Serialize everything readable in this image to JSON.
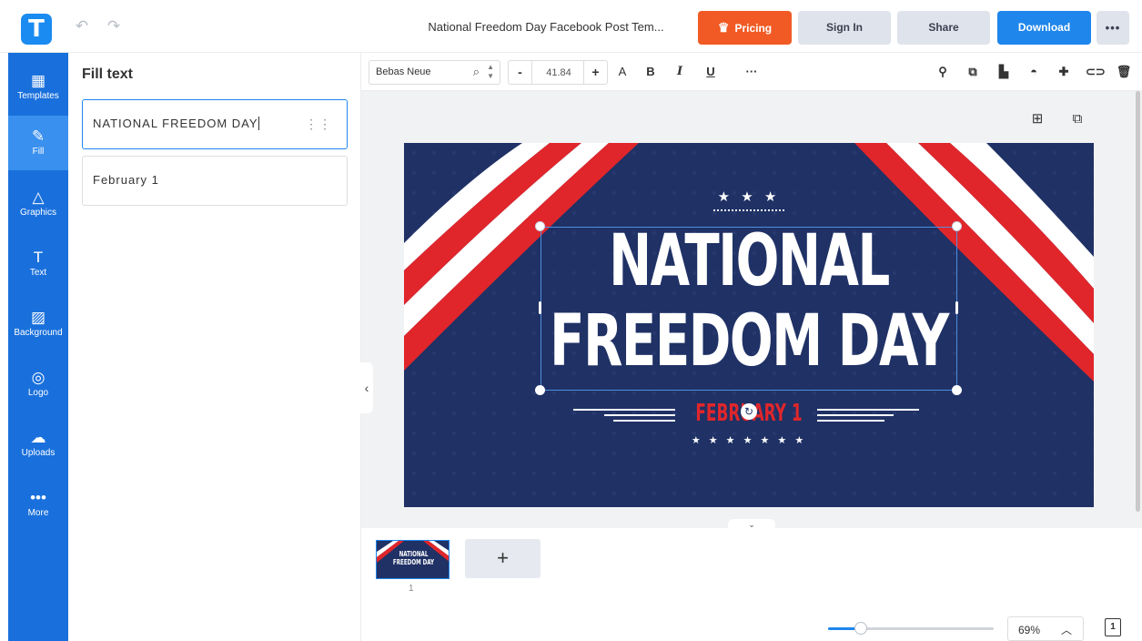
{
  "header": {
    "logo_letter": "T",
    "doc_title": "National Freedom Day Facebook Post Tem...",
    "pricing_label": "Pricing",
    "signin_label": "Sign In",
    "share_label": "Share",
    "download_label": "Download",
    "more_label": "•••",
    "accent_color": "#1f86ec",
    "pricing_color": "#f15a24"
  },
  "sidebar": {
    "items": [
      {
        "label": "Templates",
        "icon": "templates-icon"
      },
      {
        "label": "Fill",
        "icon": "pencil-icon"
      },
      {
        "label": "Graphics",
        "icon": "shapes-icon"
      },
      {
        "label": "Text",
        "icon": "text-icon"
      },
      {
        "label": "Background",
        "icon": "background-icon"
      },
      {
        "label": "Logo",
        "icon": "logo-icon"
      },
      {
        "label": "Uploads",
        "icon": "upload-cloud-icon"
      },
      {
        "label": "More",
        "icon": "more-dots-icon"
      }
    ],
    "active": "Fill"
  },
  "panel": {
    "title": "Fill text",
    "fields": [
      {
        "value": "NATIONAL FREEDOM DAY"
      },
      {
        "value": "February 1"
      }
    ]
  },
  "toolbar": {
    "font_name": "Bebas Neue",
    "font_size": "41.84",
    "minus": "-",
    "plus": "+",
    "text_color_label": "A",
    "bold_label": "B",
    "italic_label": "I",
    "underline_label": "U",
    "more_label": "···"
  },
  "canvas": {
    "line1": "NATIONAL",
    "line2": "FREEDOM DAY",
    "date": "FEBRUARY 1",
    "stars_top": "★ ★ ★",
    "stars_bottom": "★ ★ ★ ★ ★ ★ ★",
    "bg_color": "#1f3165",
    "stripe_color": "#e0262b"
  },
  "pages": {
    "thumb_line1": "NATIONAL",
    "thumb_line2": "FREEDOM DAY",
    "page_number": "1",
    "add_label": "+"
  },
  "zoom": {
    "value": "69%",
    "fraction": 0.2
  }
}
